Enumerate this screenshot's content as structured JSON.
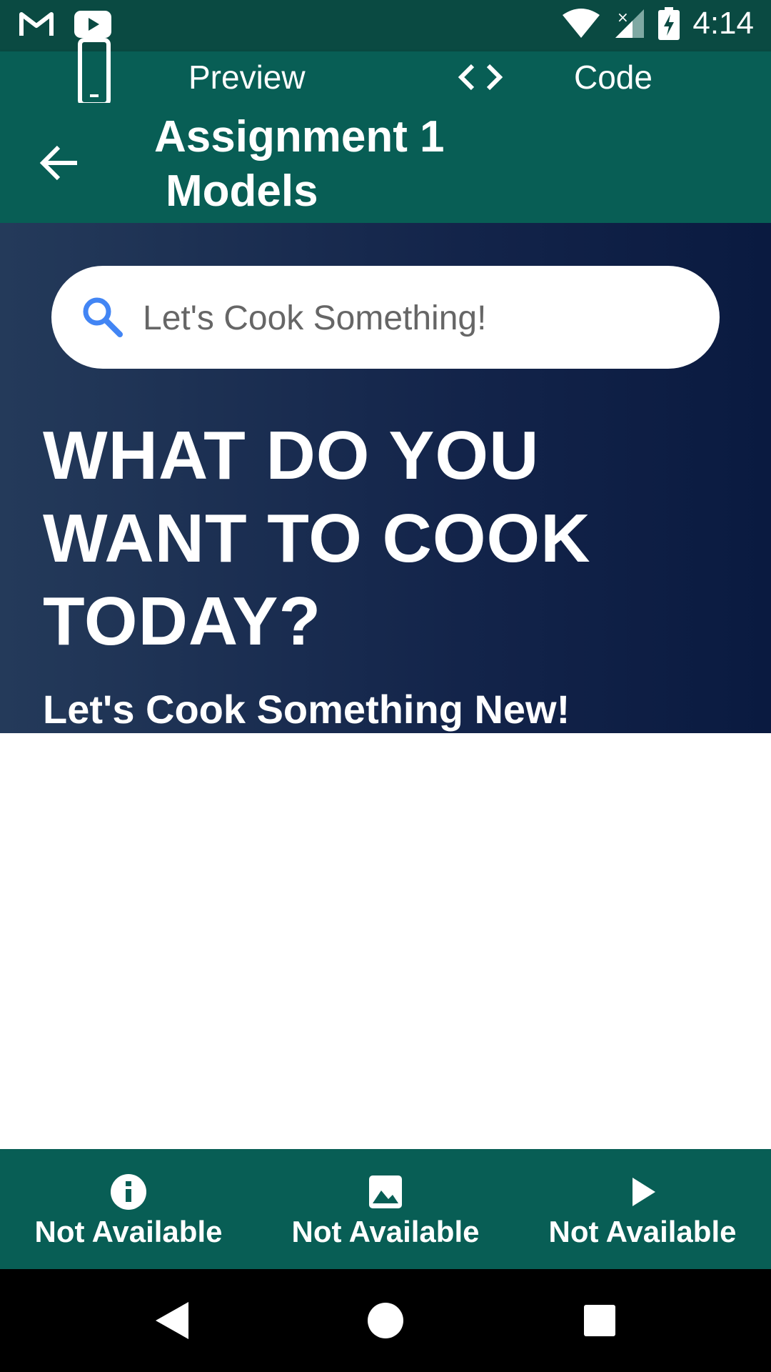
{
  "status_bar": {
    "time": "4:14",
    "icons": [
      "gmail-icon",
      "youtube-icon",
      "wifi-icon",
      "signal-icon",
      "battery-charging-icon"
    ]
  },
  "top_toggle": {
    "preview_label": "Preview",
    "code_label": "Code",
    "code_icon": "< >"
  },
  "app_bar": {
    "title_line1": "Assignment 1",
    "title_line2": "Models"
  },
  "search": {
    "placeholder": "Let's Cook Something!"
  },
  "hero": {
    "title": "WHAT DO YOU WANT TO COOK TODAY?",
    "subtitle": "Let's Cook Something New!"
  },
  "bottom_nav": {
    "items": [
      {
        "label": "Not Available",
        "icon": "info-icon"
      },
      {
        "label": "Not Available",
        "icon": "image-icon"
      },
      {
        "label": "Not Available",
        "icon": "play-icon"
      }
    ]
  },
  "colors": {
    "primary": "#085e55",
    "status_bar": "#0a4a42",
    "hero_gradient_start": "#243a5a",
    "hero_gradient_end": "#0a1a40",
    "search_icon": "#4285f4"
  }
}
